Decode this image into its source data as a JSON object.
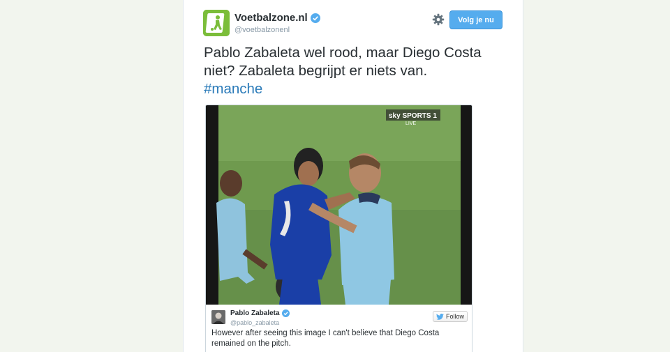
{
  "tweet": {
    "account_name": "Voetbalzone.nl",
    "handle": "@voetbalzonenl",
    "follow_label": "Volg je nu",
    "text": "Pablo Zabaleta wel rood, maar Diego Costa niet? Zabaleta begrijpt er niets van.",
    "hashtag": "#manche"
  },
  "photo": {
    "broadcaster": "sky SPORTS 1",
    "live_label": "LIVE"
  },
  "embedded_tweet": {
    "account_name": "Pablo Zabaleta",
    "handle": "@pablo_zabaleta",
    "follow_label": "Follow",
    "text": "However after seeing this image I can't believe that Diego Costa remained on the pitch."
  },
  "icons": {
    "verified": "verified-badge-icon",
    "settings": "gear-icon",
    "bird": "twitter-bird-icon"
  },
  "colors": {
    "follow_button": "#55acee",
    "hashtag": "#2b7bb9",
    "verified": "#55acee",
    "avatar": "#7bbd3a"
  }
}
